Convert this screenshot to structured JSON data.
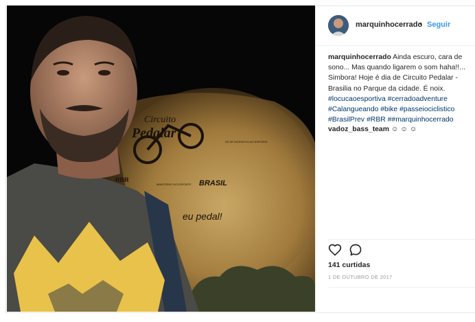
{
  "post": {
    "username": "marquinhocerrado",
    "dot": "•",
    "follow_label": "Seguir",
    "caption": {
      "username": "marquinhocerrado",
      "text": "Ainda escuro, cara de sono... Mas quando ligarem o som haha!!... Simbora! Hoje é dia de Circuito Pedalar - Brasilia no Parque da cidade. É noix.",
      "hashtags": [
        "#locucaoesportiva",
        "#cerradoadventure",
        "#Calangueando",
        "#bike",
        "#passeiociclistico",
        "#BrasilPrev",
        "#RBR",
        "##marquinhocerrado"
      ]
    },
    "comment": {
      "username": "vadoz_bass_team",
      "text": "☺ ☺ ☺"
    },
    "likes": "141 curtidas",
    "date": "1 DE OUTUBRO DE 2017"
  },
  "photo": {
    "sign_title_top": "Circuito",
    "sign_title_bottom": "Pedalar",
    "sign_slogan": "eu pedal!",
    "sign_sponsor_1": "BRASIL",
    "sign_sponsor_2": "RBR",
    "sign_small_1": "MINISTÉRIO DO ESPORTE",
    "sign_small_2": "SE DE INCENTIVO AO ESPORTE"
  },
  "icons": {
    "like": "heart-outline-icon",
    "comment": "speech-bubble-icon"
  }
}
